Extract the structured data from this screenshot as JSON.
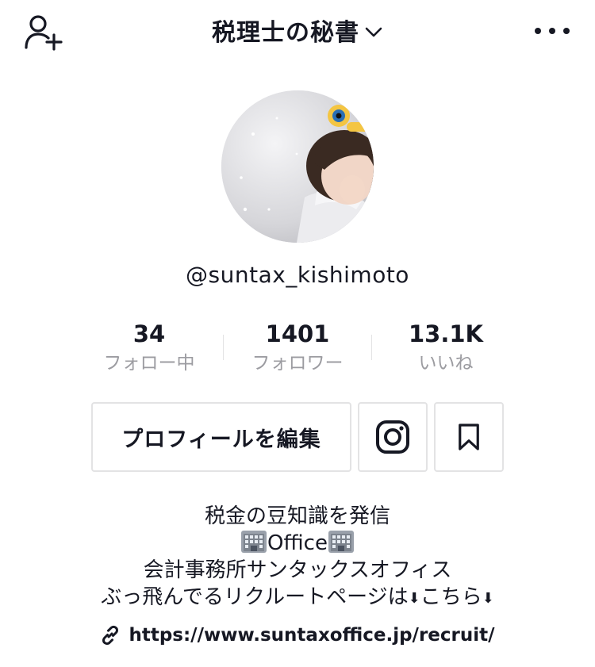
{
  "header": {
    "title": "税理士の秘書",
    "add_friend_icon": "person-add-icon",
    "dropdown_icon": "chevron-down-icon",
    "more_icon": "more-horizontal-icon"
  },
  "profile": {
    "username": "@suntax_kishimoto",
    "avatar_icon": "avatar-photo"
  },
  "stats": [
    {
      "value": "34",
      "label": "フォロー中"
    },
    {
      "value": "1401",
      "label": "フォロワー"
    },
    {
      "value": "13.1K",
      "label": "いいね"
    }
  ],
  "actions": {
    "edit_profile_label": "プロフィールを編集",
    "instagram_icon": "instagram-icon",
    "bookmark_icon": "bookmark-icon"
  },
  "bio": {
    "line1": "税金の豆知識を発信",
    "line2_text": "Office",
    "line3": "会計事務所サンタックスオフィス",
    "line4_a": "ぶっ飛んでるリクルートページは",
    "line4_arrow": "⬇",
    "line4_b": "こちら",
    "building_icon": "office-building-icon"
  },
  "link": {
    "url": "https://www.suntaxoffice.jp/recruit/",
    "icon": "link-icon"
  },
  "colors": {
    "text": "#161823",
    "secondary": "#9c9ca1",
    "border": "#e3e3e4"
  }
}
